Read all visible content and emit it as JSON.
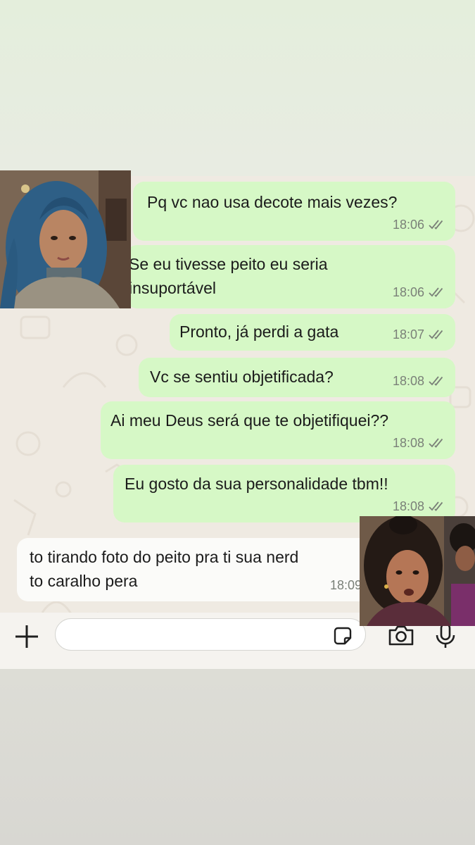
{
  "messages": [
    {
      "direction": "outgoing",
      "lines": [
        "Pq vc nao usa decote mais vezes?"
      ],
      "time": "18:06",
      "read": true
    },
    {
      "direction": "outgoing",
      "lines": [
        "Se eu tivesse peito eu seria",
        "insuportável"
      ],
      "time": "18:06",
      "read": true
    },
    {
      "direction": "outgoing",
      "lines": [
        "Pronto, já perdi a gata"
      ],
      "time": "18:07",
      "read": true
    },
    {
      "direction": "outgoing",
      "lines": [
        "Vc se sentiu objetificada?"
      ],
      "time": "18:08",
      "read": true
    },
    {
      "direction": "outgoing",
      "lines": [
        "Ai meu Deus será que te objetifiquei??"
      ],
      "time": "18:08",
      "read": true
    },
    {
      "direction": "outgoing",
      "lines": [
        "Eu gosto da sua personalidade tbm!!"
      ],
      "time": "18:08",
      "read": true
    },
    {
      "direction": "incoming",
      "lines": [
        "to tirando foto do peito pra ti sua nerd",
        "to caralho pera"
      ],
      "time": "18:09"
    }
  ],
  "composer": {
    "placeholder": ""
  },
  "icons": {
    "attach": "plus-icon",
    "sticker": "sticker-icon",
    "camera": "camera-icon",
    "microphone": "microphone-icon",
    "read_receipt": "double-check-icon"
  },
  "colors": {
    "outgoing_bubble": "#d6f8c6",
    "incoming_bubble": "#fbfbf9",
    "chat_background": "#efeae2",
    "timestamp": "#7a8078"
  }
}
